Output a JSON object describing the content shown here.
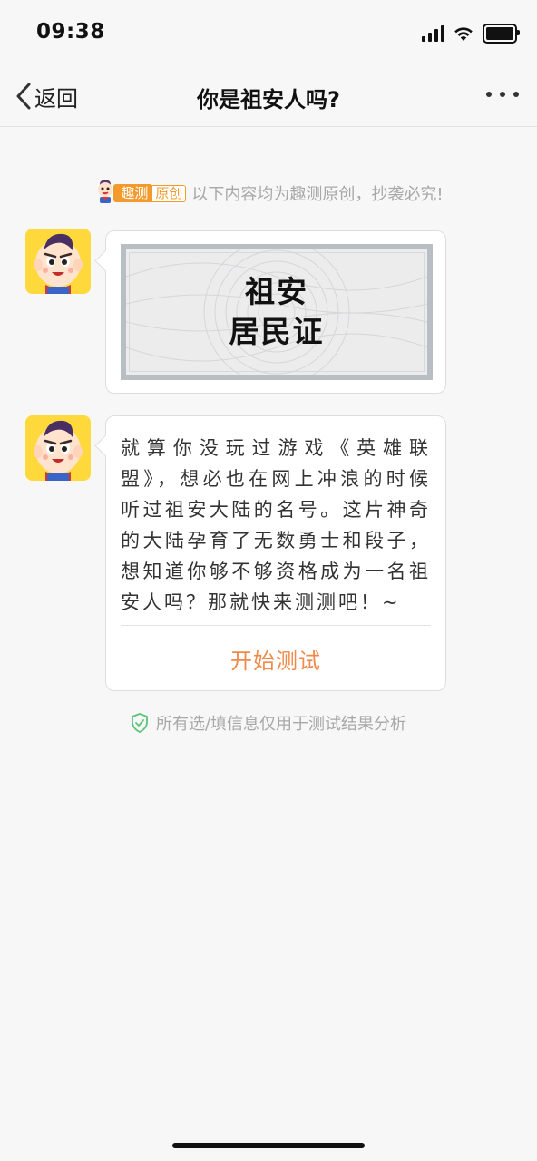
{
  "status_bar": {
    "time": "09:38",
    "signal_icon": "cellular-signal-icon",
    "wifi_icon": "wifi-icon",
    "battery_icon": "battery-icon"
  },
  "nav": {
    "back_label": "返回",
    "title": "你是祖安人吗?",
    "more_icon": "more-dots-icon"
  },
  "notice": {
    "brand_part1": "趣测",
    "brand_part2": "原创",
    "text": "以下内容均为趣测原创，抄袭必究!"
  },
  "messages": [
    {
      "type": "image",
      "certificate_line1": "祖安",
      "certificate_line2": "居民证"
    },
    {
      "type": "text",
      "text": "就算你没玩过游戏《英雄联盟》，想必也在网上冲浪的时候听过祖安大陆的名号。这片神奇的大陆孕育了无数勇士和段子，想知道你够不够资格成为一名祖安人吗？那就快来测测吧！~",
      "action_label": "开始测试"
    }
  ],
  "privacy_note": "所有选/填信息仅用于测试结果分析",
  "colors": {
    "accent_orange": "#f08a4b",
    "brand_orange": "#f39a2c",
    "avatar_yellow": "#ffd93b",
    "shield_green": "#5cc37a"
  }
}
